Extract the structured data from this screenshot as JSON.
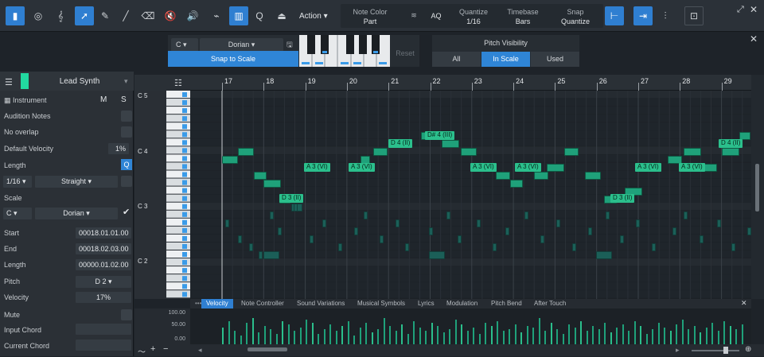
{
  "toolbar": {
    "action_label": "Action",
    "note_color_label": "Note Color",
    "note_color_value": "Part",
    "aq_label": "AQ",
    "quantize_label": "Quantize",
    "quantize_value": "1/16",
    "timebase_label": "Timebase",
    "timebase_value": "Bars",
    "snap_label": "Snap",
    "snap_value": "Quantize",
    "q_label": "Q"
  },
  "scale": {
    "root": "C",
    "mode": "Dorian",
    "snap_label": "Snap to Scale",
    "reset_label": "Reset"
  },
  "pitch_visibility": {
    "title": "Pitch Visibility",
    "options": [
      "All",
      "In Scale",
      "Used"
    ],
    "selected": "In Scale"
  },
  "track": {
    "name": "Lead Synth",
    "instrument_label": "Instrument",
    "m_label": "M",
    "s_label": "S"
  },
  "inspector": {
    "audition": "Audition Notes",
    "overlap": "No overlap",
    "default_velocity_label": "Default Velocity",
    "default_velocity": "1%",
    "length_label": "Length",
    "length_value": "1/16",
    "length_mode": "Straight",
    "scale_label": "Scale",
    "scale_root": "C",
    "scale_mode": "Dorian",
    "start_label": "Start",
    "start_value": "00018.01.01.00",
    "end_label": "End",
    "end_value": "00018.02.03.00",
    "len2_label": "Length",
    "len2_value": "00000.01.02.00",
    "pitch_label": "Pitch",
    "pitch_value": "D 2",
    "velocity_label": "Velocity",
    "velocity_value": "17%",
    "mute_label": "Mute",
    "input_chord_label": "Input Chord",
    "current_chord_label": "Current Chord"
  },
  "ruler": [
    "17",
    "18",
    "19",
    "20",
    "21",
    "22",
    "23",
    "24",
    "25",
    "26",
    "27",
    "28",
    "29"
  ],
  "octaves": [
    "C 5",
    "C 4",
    "C 3",
    "C 2"
  ],
  "note_labels": [
    "D 4 (II)",
    "D# 4 (III)",
    "A 3 (VI)",
    "A 3 (VI)",
    "D 3 (II)",
    "A 3 (VI)",
    "A 3 (VI)",
    "D 3 (II)",
    "A 3 (VI)",
    "A 3 (VI)",
    "D 4 (II)"
  ],
  "editor_tabs": [
    "Velocity",
    "Note Controller",
    "Sound Variations",
    "Musical Symbols",
    "Lyrics",
    "Modulation",
    "Pitch Bend",
    "After Touch"
  ],
  "vel_axis": [
    "100.00",
    "50.00",
    "0.00"
  ],
  "colors": {
    "accent": "#2f7fd1",
    "note": "#1fa17a"
  }
}
